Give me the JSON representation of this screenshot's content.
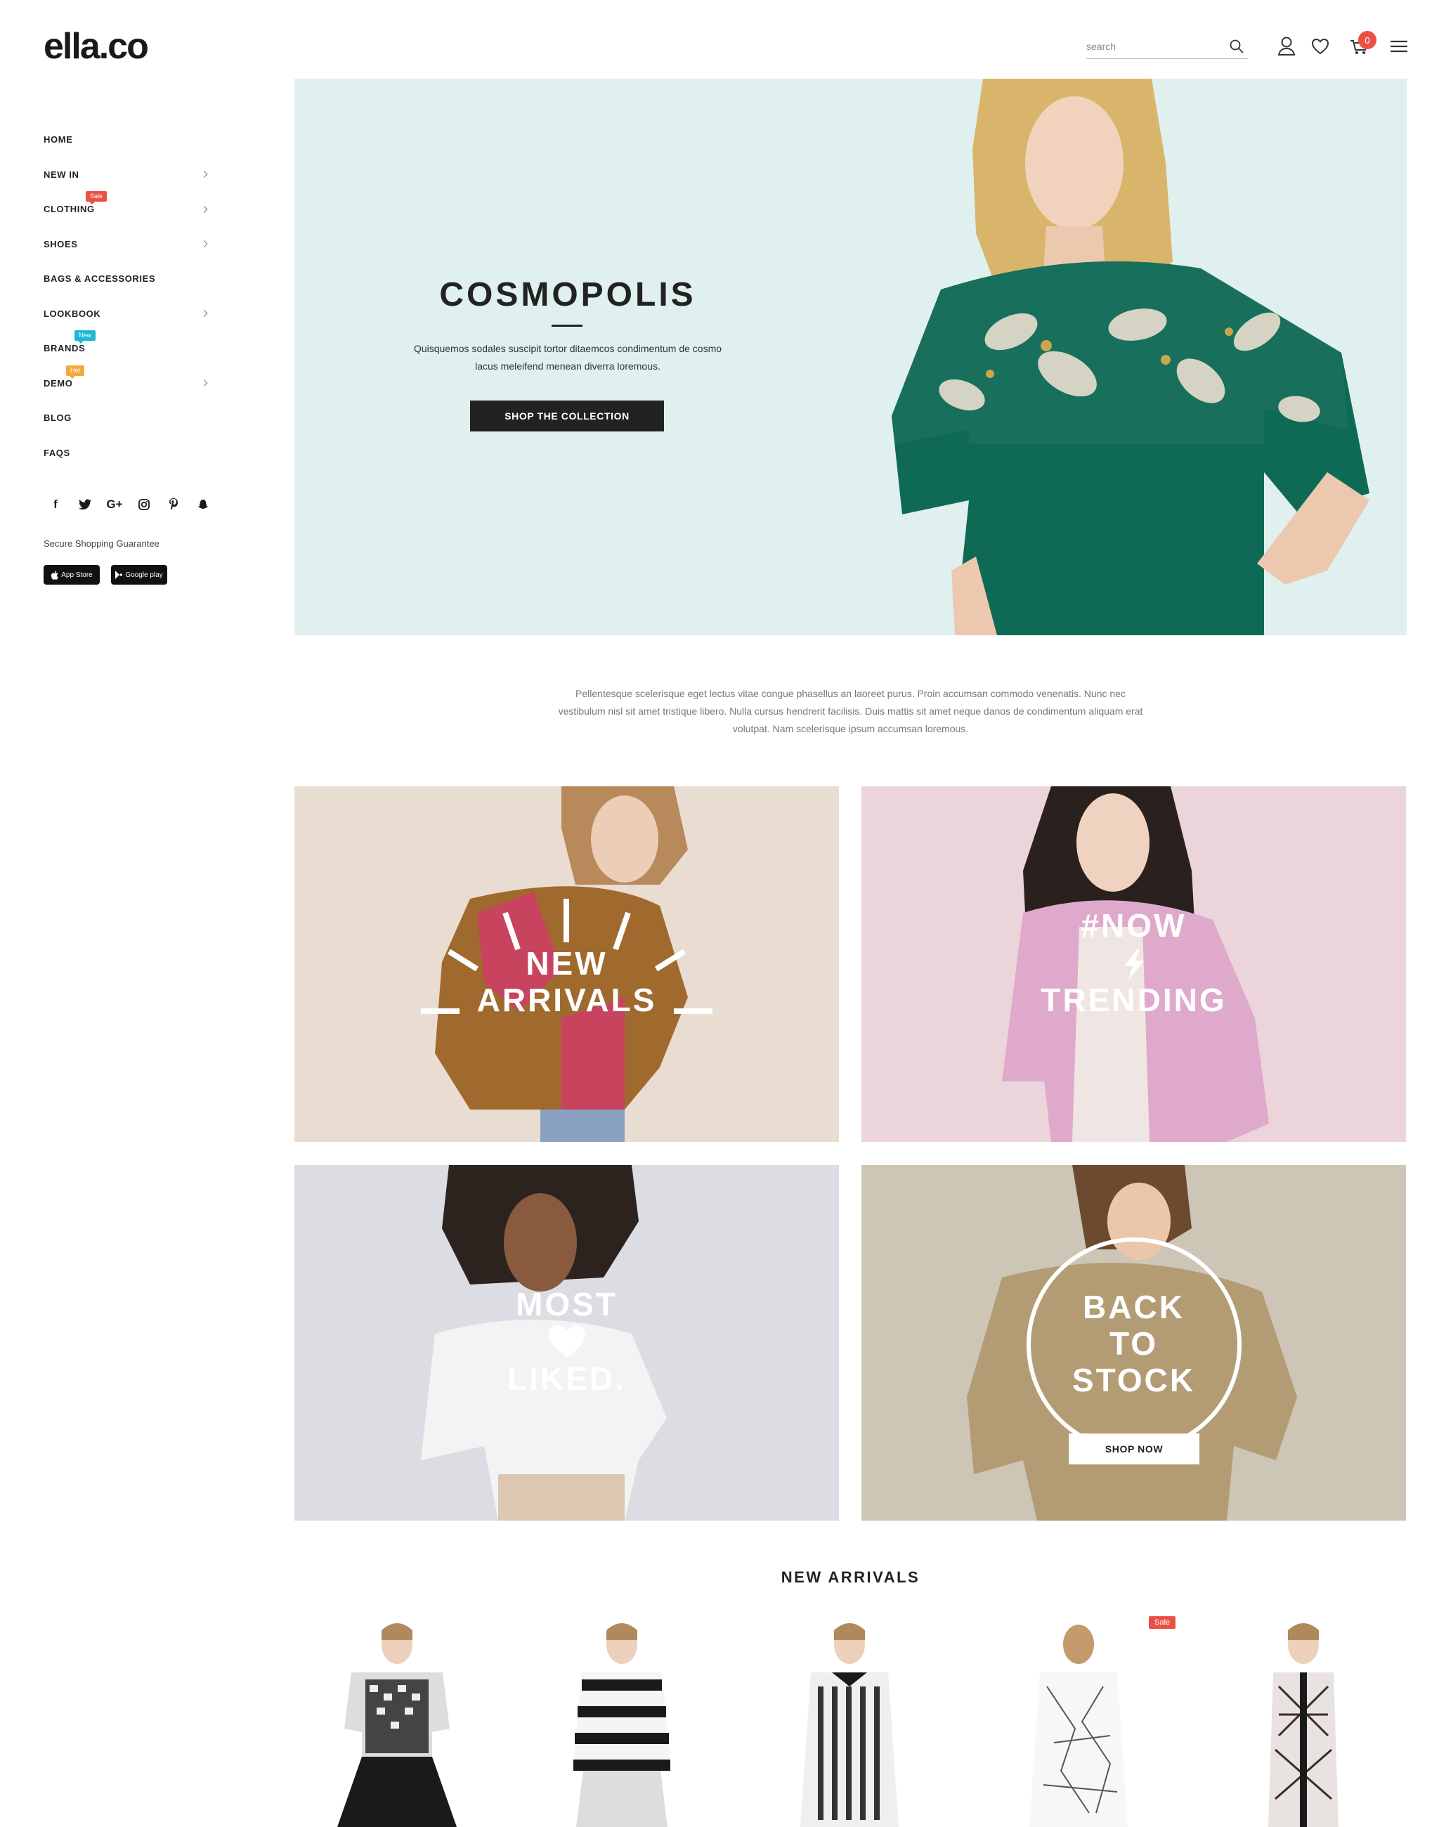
{
  "header": {
    "logo": "ella.co",
    "search_placeholder": "search",
    "cart_count": "0"
  },
  "sidebar": {
    "items": [
      {
        "label": "HOME"
      },
      {
        "label": "NEW IN"
      },
      {
        "label": "CLOTHING",
        "badge": "Sale"
      },
      {
        "label": "SHOES"
      },
      {
        "label": "BAGS & ACCESSORIES"
      },
      {
        "label": "LOOKBOOK"
      },
      {
        "label": "BRANDS",
        "badge": "New"
      },
      {
        "label": "DEMO",
        "badge": "Hot"
      },
      {
        "label": "BLOG"
      },
      {
        "label": "FAQS"
      }
    ],
    "social": [
      "f",
      "t",
      "G+",
      "ig",
      "P",
      "sc"
    ],
    "secure_text": "Secure Shopping Guarantee",
    "app_store": "App Store",
    "google_play": "Google play"
  },
  "hero": {
    "title": "COSMOPOLIS",
    "text": "Quisquemos sodales suscipit tortor ditaemcos condimentum de cosmo lacus meleifend menean diverra loremous.",
    "button": "SHOP THE COLLECTION"
  },
  "intro": "Pellentesque scelerisque eget lectus vitae congue phasellus an laoreet purus. Proin accumsan commodo venenatis. Nunc nec vestibulum nisl sit amet tristique libero. Nulla cursus hendrerit facilisis. Duis mattis sit amet neque danos de condimentum aliquam erat volutpat. Nam scelerisque ipsum accumsan loremous.",
  "banners": {
    "new_arrivals": {
      "line1": "NEW",
      "line2": "ARRIVALS"
    },
    "trending": {
      "line1": "#NOW",
      "line2": "TRENDING"
    },
    "most_liked": {
      "line1": "MOST",
      "line2": "LIKED."
    },
    "back_to_stock": {
      "line1": "BACK",
      "line2": "TO",
      "line3": "STOCK",
      "button": "SHOP NOW"
    }
  },
  "new_arrivals": {
    "title": "NEW ARRIVALS",
    "products": [
      {
        "badge": ""
      },
      {
        "badge": ""
      },
      {
        "badge": ""
      },
      {
        "badge": "Sale"
      },
      {
        "badge": ""
      }
    ]
  },
  "colors": {
    "accent": "#e95144",
    "new_badge": "#1cb8d4",
    "hot_badge": "#f3a93c",
    "hero_bg": "#dff0ef"
  }
}
